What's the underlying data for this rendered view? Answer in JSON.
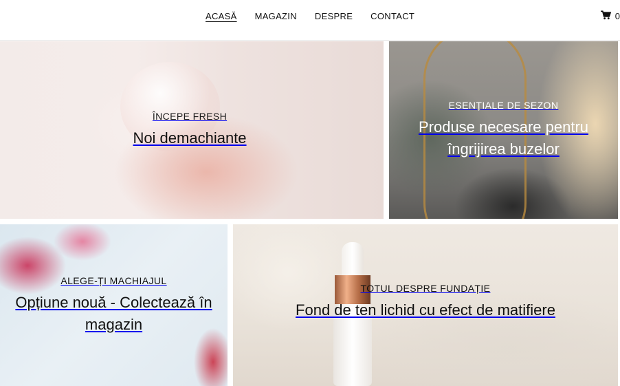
{
  "nav": {
    "items": [
      {
        "label": "ACASĂ",
        "active": true
      },
      {
        "label": "MAGAZIN",
        "active": false
      },
      {
        "label": "DESPRE",
        "active": false
      },
      {
        "label": "CONTACT",
        "active": false
      }
    ]
  },
  "cart": {
    "icon": "cart-icon",
    "count": "0"
  },
  "tiles": [
    {
      "eyebrow": "ÎNCEPE FRESH",
      "headline": "Noi demachiante"
    },
    {
      "eyebrow": "ESENȚIALE DE SEZON",
      "headline": "Produse necesare pentru îngrijirea buzelor"
    },
    {
      "eyebrow": "ALEGE-ȚI MACHIAJUL",
      "headline": "Opțiune nouă - Colectează în magazin"
    },
    {
      "eyebrow": "TOTUL DESPRE FUNDAȚIE",
      "headline": "Fond de ten lichid cu efect de matifiere"
    }
  ],
  "colors": {
    "text": "#111111",
    "tile_text_light": "#ffffff",
    "header_border": "#e6e6e6"
  }
}
